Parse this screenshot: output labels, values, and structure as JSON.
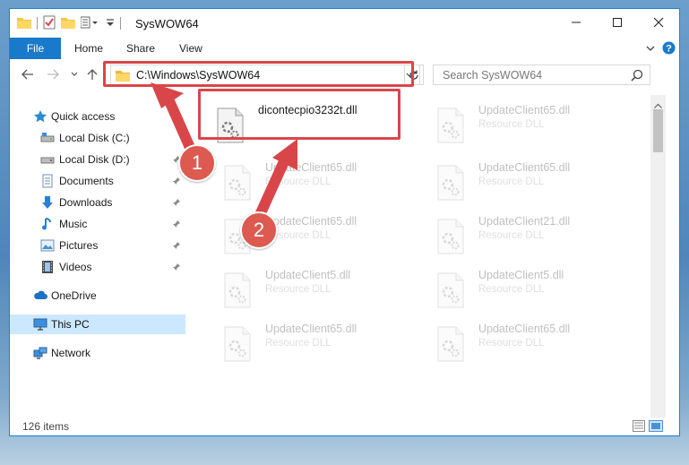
{
  "window": {
    "title": "SysWOW64"
  },
  "ribbon": {
    "tabs": [
      {
        "label": "File"
      },
      {
        "label": "Home"
      },
      {
        "label": "Share"
      },
      {
        "label": "View"
      }
    ]
  },
  "address": {
    "path": "C:\\Windows\\SysWOW64"
  },
  "search": {
    "placeholder": "Search SysWOW64"
  },
  "sidebar": {
    "items": [
      {
        "label": "Quick access"
      },
      {
        "label": "Local Disk (C:)"
      },
      {
        "label": "Local Disk (D:)"
      },
      {
        "label": "Documents"
      },
      {
        "label": "Downloads"
      },
      {
        "label": "Music"
      },
      {
        "label": "Pictures"
      },
      {
        "label": "Videos"
      },
      {
        "label": "OneDrive"
      },
      {
        "label": "This PC"
      },
      {
        "label": "Network"
      }
    ]
  },
  "files": [
    {
      "name": "dicontecpio3232t.dll",
      "type": ""
    },
    {
      "name": "UpdateClient65.dll",
      "type": "Resource DLL"
    },
    {
      "name": "UpdateClient65.dll",
      "type": "Resource DLL"
    },
    {
      "name": "UpdateClient65.dll",
      "type": "Resource DLL"
    },
    {
      "name": "UpdateClient65.dll",
      "type": "Resource DLL"
    },
    {
      "name": "UpdateClient21.dll",
      "type": "Resource DLL"
    },
    {
      "name": "UpdateClient5.dll",
      "type": "Resource DLL"
    },
    {
      "name": "UpdateClient5.dll",
      "type": "Resource DLL"
    },
    {
      "name": "UpdateClient65.dll",
      "type": "Resource DLL"
    },
    {
      "name": "UpdateClient65.dll",
      "type": "Resource DLL"
    }
  ],
  "status": {
    "count": "126 items"
  },
  "annotations": {
    "step1": "1",
    "step2": "2",
    "color": "#d9464a"
  }
}
